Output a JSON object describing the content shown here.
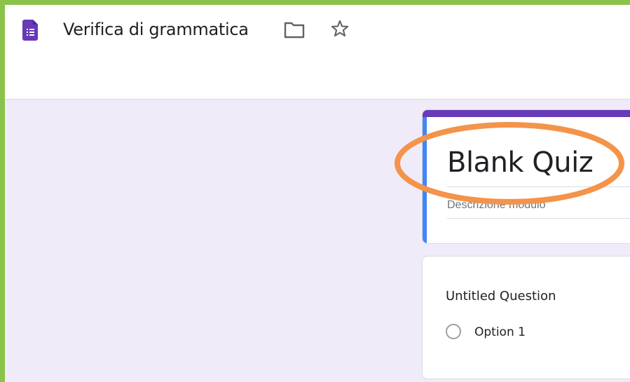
{
  "header": {
    "title": "Verifica di grammatica",
    "forms_icon": "google-forms-icon",
    "folder_icon": "folder-icon",
    "star_icon": "star-icon"
  },
  "form": {
    "title": "Blank Quiz",
    "description_placeholder": "Descrizione modulo",
    "questions": [
      {
        "title": "Untitled Question",
        "options": [
          "Option 1"
        ]
      }
    ]
  },
  "colors": {
    "theme_purple": "#673ab7",
    "accent_blue": "#4285f4",
    "page_background": "#f0ebf8",
    "annotation_orange": "#f4934a",
    "outer_border_green": "#8bc34a"
  }
}
